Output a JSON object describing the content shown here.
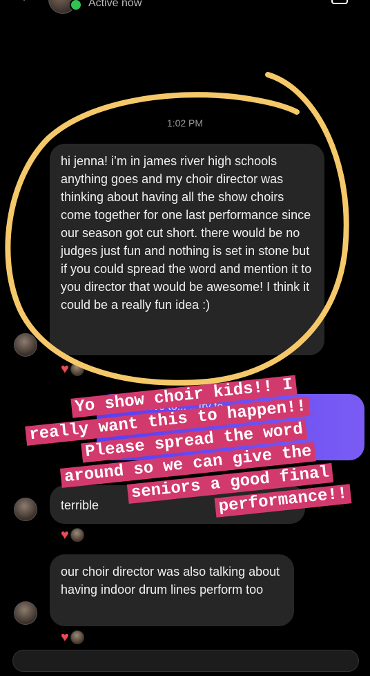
{
  "header": {
    "status": "Active now"
  },
  "conversation": {
    "timestamp": "1:02 PM",
    "messages": [
      {
        "text": "hi jenna! i’m in james river high schools anything goes and my choir director was thinking about having all the show choirs come together for one last performance since our season got cut short. there would be no judges just fun and nothing is set in stone but if you could spread the word and mention it to you director that would be awesome! I think it could be a really fun idea :)",
        "reaction": "heart"
      },
      {
        "text": "terrible",
        "reaction": "heart"
      },
      {
        "text": "our choir director was also talking about having indoor drum lines perform too",
        "reaction": "heart"
      }
    ],
    "reply_bubble_partial": "...would love to... ...try to... ...ended early..."
  },
  "overlay": {
    "sticker_lines": [
      "Yo show choir kids!! I",
      "really want this to happen!!",
      "Please spread the word",
      "around so we can give the",
      "seniors a good final",
      "performance!!"
    ],
    "sticker_color": "#d23a6e",
    "circle_color": "#f5c86a"
  },
  "icons": [
    "back-icon",
    "video-call-icon",
    "heart-icon",
    "online-status-icon"
  ]
}
